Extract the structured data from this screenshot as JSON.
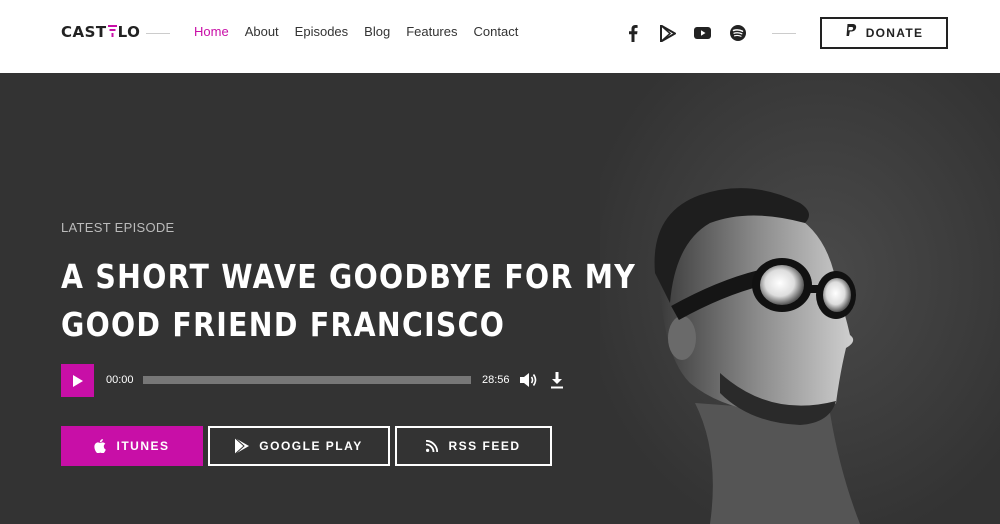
{
  "brand": {
    "logo_left": "CAST",
    "logo_right": "LO"
  },
  "nav": {
    "items": [
      {
        "label": "Home",
        "active": true
      },
      {
        "label": "About"
      },
      {
        "label": "Episodes"
      },
      {
        "label": "Blog"
      },
      {
        "label": "Features"
      },
      {
        "label": "Contact"
      }
    ]
  },
  "social": [
    "facebook-icon",
    "google-play-icon",
    "youtube-icon",
    "spotify-icon"
  ],
  "donate": {
    "label": "DONATE",
    "icon": "paypal-icon"
  },
  "hero": {
    "eyebrow": "LATEST EPISODE",
    "title_line1": "A SHORT WAVE GOODBYE FOR MY",
    "title_line2": "GOOD FRIEND FRANCISCO"
  },
  "player": {
    "current_time": "00:00",
    "duration": "28:56",
    "progress": 0
  },
  "subscribe": {
    "itunes": "ITUNES",
    "google_play": "GOOGLE PLAY",
    "rss": "RSS FEED"
  },
  "colors": {
    "accent": "#c80fa7",
    "hero_bg": "#333333",
    "header_bg": "#ffffff"
  }
}
